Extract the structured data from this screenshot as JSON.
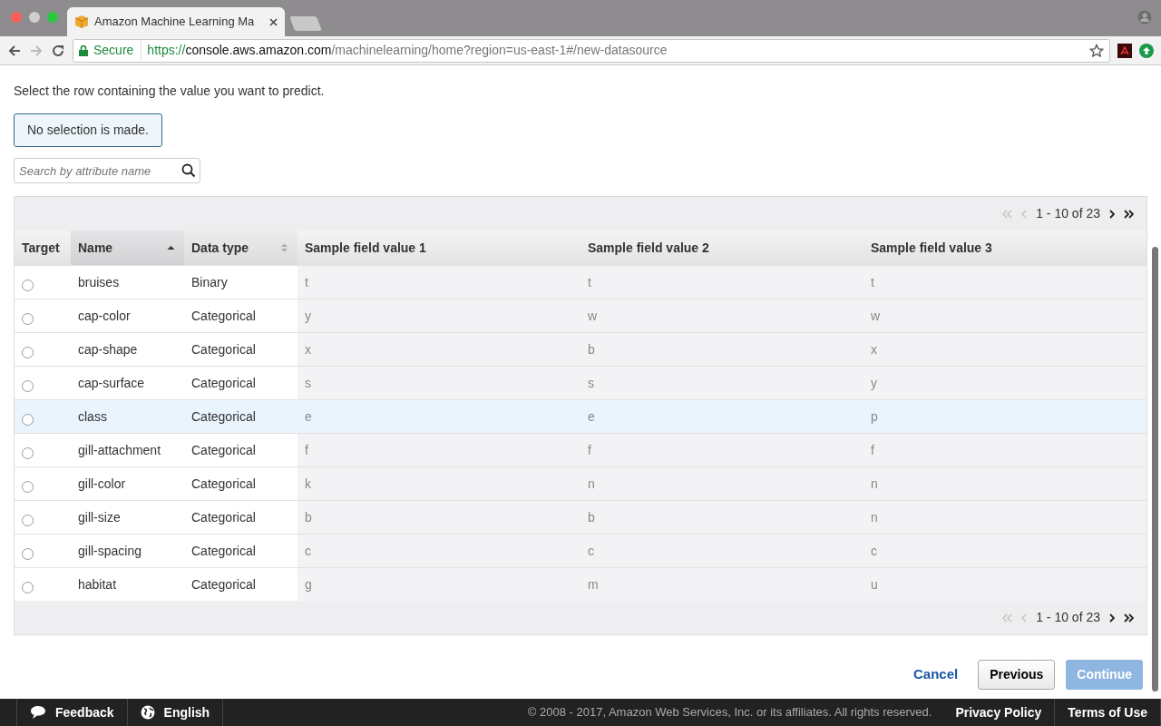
{
  "browser": {
    "tab_title": "Amazon Machine Learning Ma",
    "security": "Secure",
    "url_scheme": "https://",
    "url_host": "console.aws.amazon.com",
    "url_path": "/machinelearning/home?region=us-east-1#/new-datasource"
  },
  "instruction": "Select the row containing the value you want to predict.",
  "selection_status": "No selection is made.",
  "search": {
    "placeholder": "Search by attribute name"
  },
  "pagination_top": {
    "range": "1 - 10 of 23"
  },
  "table": {
    "columns": [
      {
        "label": "Target",
        "sortable": false
      },
      {
        "label": "Name",
        "sortable": true,
        "sorted_ascending": true
      },
      {
        "label": "Data type",
        "sortable": true,
        "sorted_ascending": false
      },
      {
        "label": "Sample field value 1",
        "sortable": false
      },
      {
        "label": "Sample field value 2",
        "sortable": false
      },
      {
        "label": "Sample field value 3",
        "sortable": false
      }
    ],
    "rows": [
      {
        "selected": false,
        "highlighted": false,
        "cells": [
          "",
          "bruises",
          "Binary",
          "t",
          "t",
          "t"
        ]
      },
      {
        "selected": false,
        "highlighted": false,
        "cells": [
          "",
          "cap-color",
          "Categorical",
          "y",
          "w",
          "w"
        ]
      },
      {
        "selected": false,
        "highlighted": false,
        "cells": [
          "",
          "cap-shape",
          "Categorical",
          "x",
          "b",
          "x"
        ]
      },
      {
        "selected": false,
        "highlighted": false,
        "cells": [
          "",
          "cap-surface",
          "Categorical",
          "s",
          "s",
          "y"
        ]
      },
      {
        "selected": false,
        "highlighted": true,
        "cells": [
          "",
          "class",
          "Categorical",
          "e",
          "e",
          "p"
        ]
      },
      {
        "selected": false,
        "highlighted": false,
        "cells": [
          "",
          "gill-attachment",
          "Categorical",
          "f",
          "f",
          "f"
        ]
      },
      {
        "selected": false,
        "highlighted": false,
        "cells": [
          "",
          "gill-color",
          "Categorical",
          "k",
          "n",
          "n"
        ]
      },
      {
        "selected": false,
        "highlighted": false,
        "cells": [
          "",
          "gill-size",
          "Categorical",
          "b",
          "b",
          "n"
        ]
      },
      {
        "selected": false,
        "highlighted": false,
        "cells": [
          "",
          "gill-spacing",
          "Categorical",
          "c",
          "c",
          "c"
        ]
      },
      {
        "selected": false,
        "highlighted": false,
        "cells": [
          "",
          "habitat",
          "Categorical",
          "g",
          "m",
          "u"
        ]
      }
    ]
  },
  "pagination_bottom": {
    "range": "1 - 10 of 23"
  },
  "buttons": [
    {
      "kind": "link",
      "label": "Cancel"
    },
    {
      "kind": "default",
      "label": "Previous"
    },
    {
      "kind": "primary",
      "label": "Continue",
      "disabled": true
    }
  ],
  "footer": {
    "feedback": "Feedback",
    "language": "English",
    "copyright": "© 2008 - 2017, Amazon Web Services, Inc. or its affiliates. All rights reserved.",
    "links": [
      "Privacy Policy",
      "Terms of Use"
    ]
  }
}
